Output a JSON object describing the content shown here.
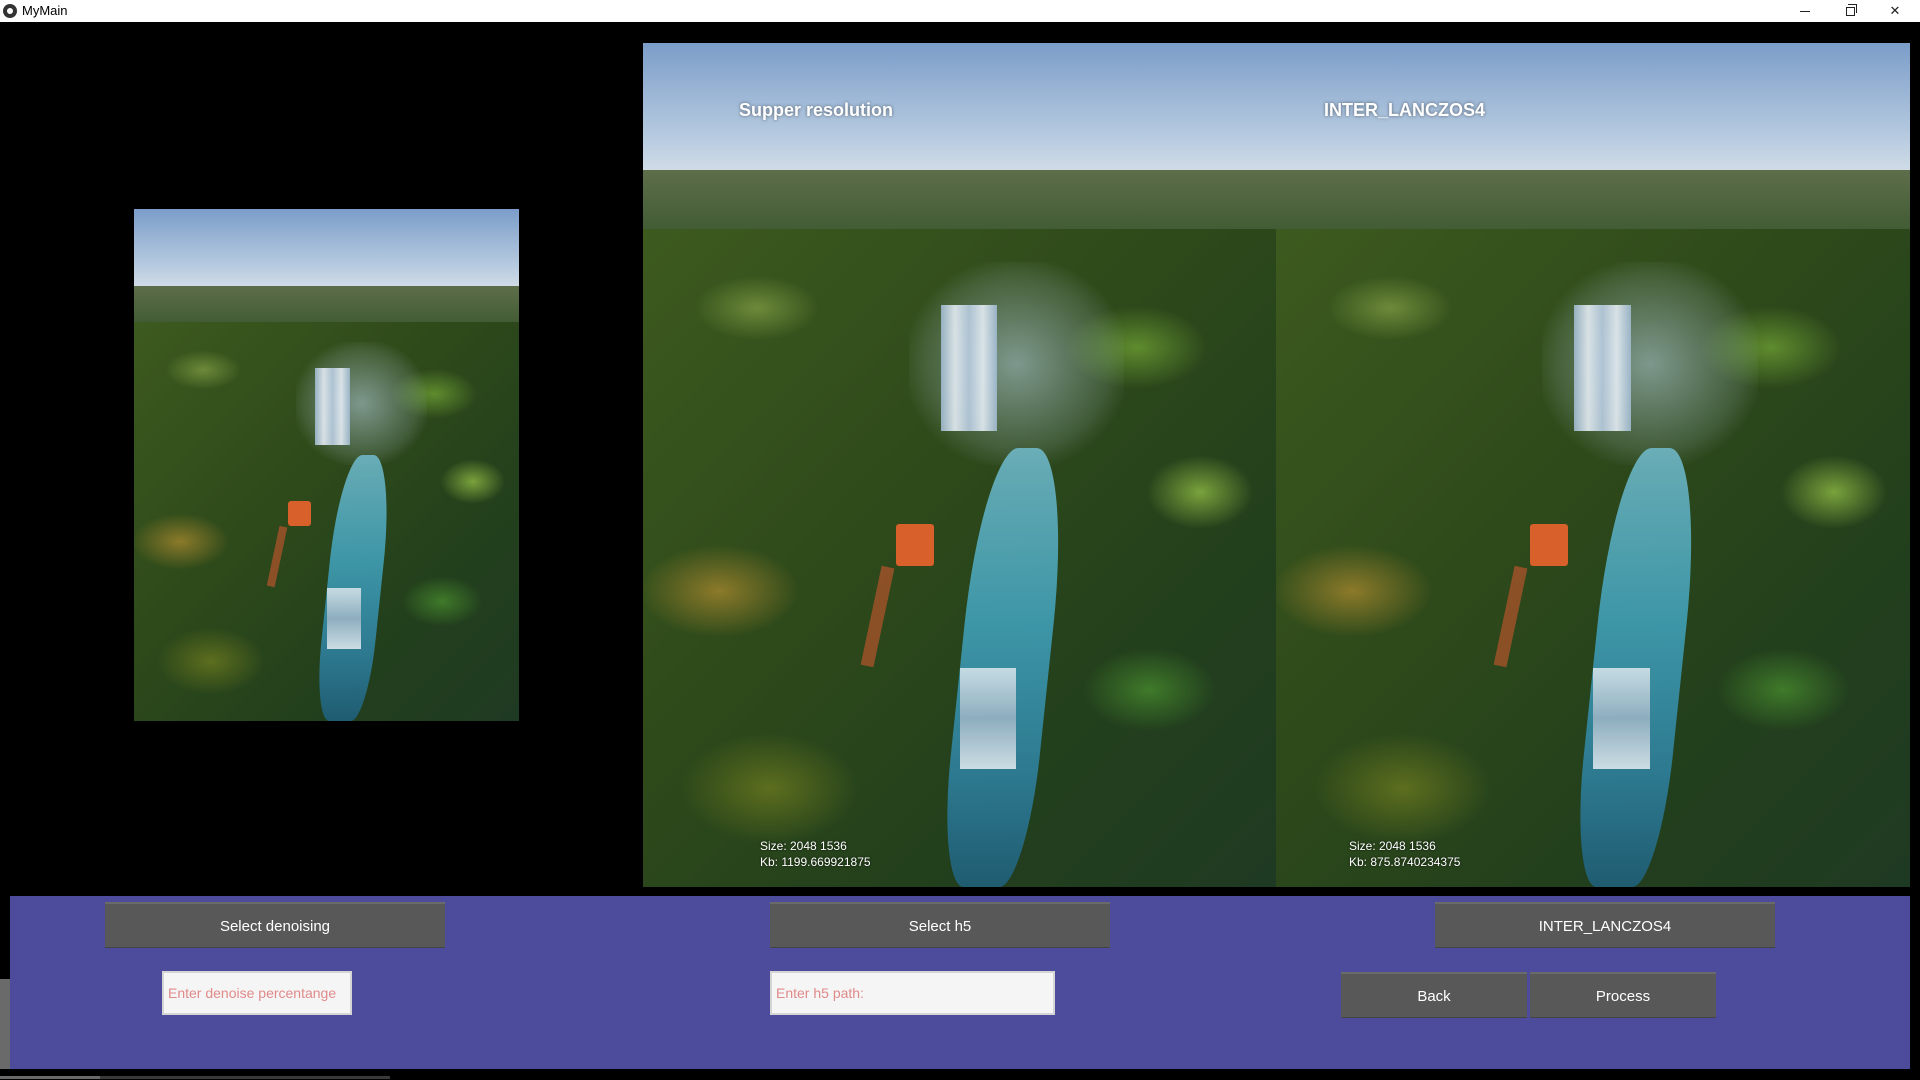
{
  "window": {
    "title": "MyMain",
    "controls": {
      "minimize": "minimize-icon",
      "maximize": "restore-icon",
      "close": "close-icon",
      "close_glyph": "✕"
    }
  },
  "images": {
    "superres": {
      "label": "Supper resolution",
      "size_text": "Size: 2048 1536",
      "kb_text": "Kb: 1199.669921875"
    },
    "lanczos": {
      "label": "INTER_LANCZOS4",
      "size_text": "Size: 2048 1536",
      "kb_text": "Kb: 875.8740234375"
    }
  },
  "controls": {
    "select_denoising_label": "Select denoising",
    "select_h5_label": "Select h5",
    "interpolation_label": "INTER_LANCZOS4",
    "back_label": "Back",
    "process_label": "Process",
    "denoise_placeholder": "Enter denoise percentange",
    "h5_placeholder": "Enter h5 path:"
  },
  "colors": {
    "panel": "#4d4b9b",
    "button": "#585858",
    "placeholder": "#e08a8a"
  }
}
